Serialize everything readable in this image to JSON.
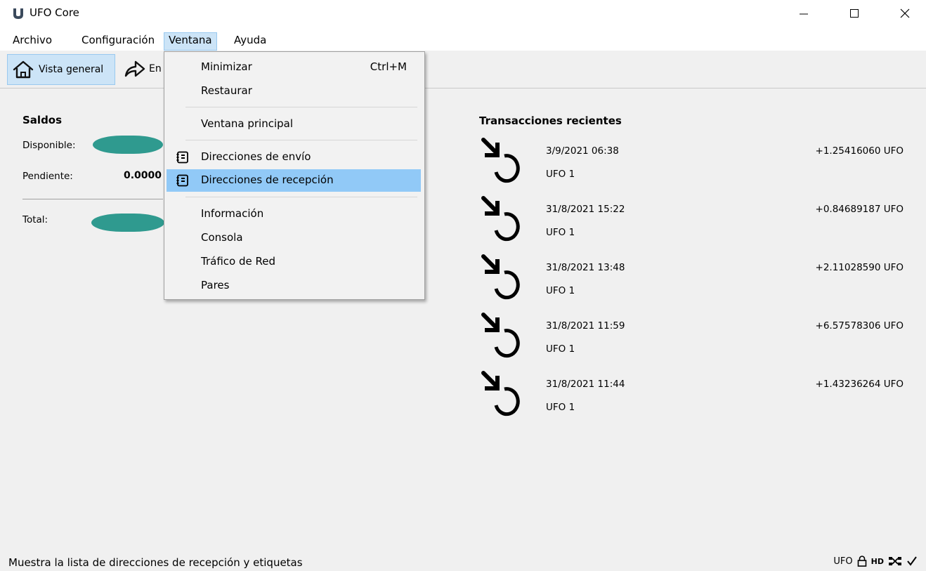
{
  "window": {
    "title": "UFO Core",
    "controls": {
      "minimize_icon": "minimize-icon",
      "maximize_icon": "maximize-icon",
      "close_icon": "close-icon"
    }
  },
  "menubar": {
    "items": [
      {
        "label": "Archivo"
      },
      {
        "label": "Configuración"
      },
      {
        "label": "Ventana",
        "active": true
      },
      {
        "label": "Ayuda"
      }
    ]
  },
  "toolbar": {
    "overview_label": "Vista general",
    "send_label_visible": "En"
  },
  "overview": {
    "balances_title": "Saldos",
    "available_label": "Disponible:",
    "pending_label": "Pendiente:",
    "pending_value": "0.0000",
    "total_label": "Total:"
  },
  "recent": {
    "title": "Transacciones recientes",
    "transactions": [
      {
        "date": "3/9/2021 06:38",
        "label": "UFO 1",
        "amount": "+1.25416060 UFO"
      },
      {
        "date": "31/8/2021 15:22",
        "label": "UFO 1",
        "amount": "+0.84689187 UFO"
      },
      {
        "date": "31/8/2021 13:48",
        "label": "UFO 1",
        "amount": "+2.11028590 UFO"
      },
      {
        "date": "31/8/2021 11:59",
        "label": "UFO 1",
        "amount": "+6.57578306 UFO"
      },
      {
        "date": "31/8/2021 11:44",
        "label": "UFO 1",
        "amount": "+1.43236264 UFO"
      }
    ]
  },
  "dropdown": {
    "minimize": {
      "label": "Minimizar",
      "shortcut": "Ctrl+M"
    },
    "restore": {
      "label": "Restaurar"
    },
    "main_window": {
      "label": "Ventana principal"
    },
    "sending_addresses": {
      "label": "Direcciones de envío",
      "icon": "address-book-icon"
    },
    "receiving_addresses": {
      "label": "Direcciones de recepción",
      "icon": "address-book-icon",
      "highlighted": true
    },
    "information": {
      "label": "Información"
    },
    "console": {
      "label": "Consola"
    },
    "network_traffic": {
      "label": "Tráfico de Red"
    },
    "peers": {
      "label": "Pares"
    }
  },
  "statusbar": {
    "message": "Muestra la lista de direcciones de recepción y etiquetas",
    "unit": "UFO",
    "hd_label": "HD",
    "icons": [
      "lock-icon",
      "hd-icon",
      "network-icon",
      "synced-check-icon"
    ]
  },
  "colors": {
    "highlight": "#91c9f7",
    "active_menu": "#cce4f7",
    "redaction": "#2f9a8f"
  }
}
